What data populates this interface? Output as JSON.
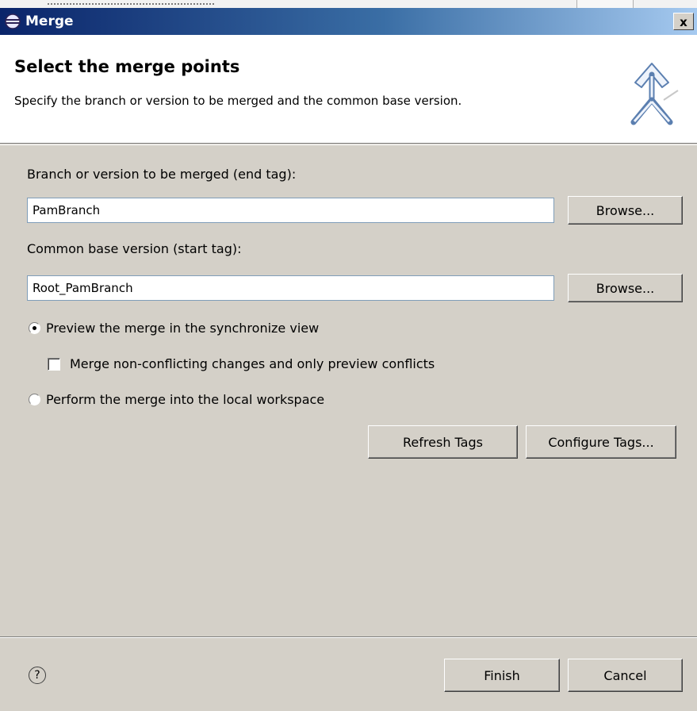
{
  "window": {
    "title": "Merge",
    "close_glyph": "x"
  },
  "banner": {
    "heading": "Select the merge points",
    "description": "Specify the branch or version to be merged and the common base version.",
    "icon": "merge-arrows-icon"
  },
  "form": {
    "end_tag_label": "Branch or version to be merged (end tag):",
    "end_tag_value": "PamBranch",
    "start_tag_label": "Common base version (start tag):",
    "start_tag_value": "Root_PamBranch",
    "browse_label": "Browse...",
    "preview_radio_label": "Preview the merge in the synchronize view",
    "preview_radio_selected": true,
    "nonconflicting_checkbox_label": "Merge non-conflicting changes and only preview conflicts",
    "nonconflicting_checked": false,
    "perform_radio_label": "Perform the merge into the local workspace",
    "perform_radio_selected": false,
    "refresh_tags_label": "Refresh Tags",
    "configure_tags_label": "Configure Tags..."
  },
  "footer": {
    "help_glyph": "?",
    "finish_label": "Finish",
    "cancel_label": "Cancel"
  }
}
